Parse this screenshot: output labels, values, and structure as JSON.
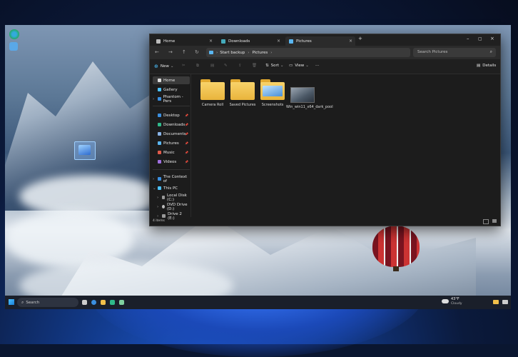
{
  "explorer": {
    "tabs": [
      {
        "label": "Home"
      },
      {
        "label": "Downloads"
      },
      {
        "label": "Pictures"
      }
    ],
    "breadcrumb": [
      "Start backup",
      "Pictures"
    ],
    "search_placeholder": "Search Pictures",
    "toolbar": {
      "new_label": "New",
      "sort_label": "Sort",
      "view_label": "View",
      "more_label": "···",
      "details_label": "Details"
    },
    "sidebar": [
      {
        "label": "Home",
        "icon": "home-icon",
        "pinned": false,
        "active": true
      },
      {
        "label": "Gallery",
        "icon": "gallery-icon",
        "pinned": false
      },
      {
        "label": "Phantom - Pers",
        "icon": "onedrive-icon",
        "pinned": false
      },
      {
        "label": "Desktop",
        "icon": "desktop-icon",
        "pinned": true
      },
      {
        "label": "Downloads",
        "icon": "downloads-icon",
        "pinned": true
      },
      {
        "label": "Documents",
        "icon": "documents-icon",
        "pinned": true
      },
      {
        "label": "Pictures",
        "icon": "pictures-icon",
        "pinned": true
      },
      {
        "label": "Music",
        "icon": "music-icon",
        "pinned": true
      },
      {
        "label": "Videos",
        "icon": "videos-icon",
        "pinned": true
      },
      {
        "label": "The Context of",
        "icon": "folder-icon",
        "pinned": false
      },
      {
        "label": "This PC",
        "icon": "pc-icon",
        "pinned": false
      },
      {
        "label": "Local Disk (C:)",
        "icon": "disk-icon",
        "pinned": false
      },
      {
        "label": "DVD Drive (D:)",
        "icon": "dvd-icon",
        "pinned": false
      },
      {
        "label": "Drive 2 (E:)",
        "icon": "disk-icon",
        "pinned": false
      }
    ],
    "items": [
      {
        "name": "Camera Roll",
        "kind": "folder"
      },
      {
        "name": "Saved Pictures",
        "kind": "folder"
      },
      {
        "name": "Screenshots",
        "kind": "folder-image"
      },
      {
        "name": "Win_win11_x64_dark_pool",
        "kind": "image"
      }
    ],
    "status": "4 items"
  },
  "taskbar": {
    "search_label": "Search",
    "weather_temp": "43°F",
    "weather_desc": "Cloudy"
  },
  "colors": {
    "accent": "#4cc2ff",
    "folder": "#f2c04a"
  }
}
